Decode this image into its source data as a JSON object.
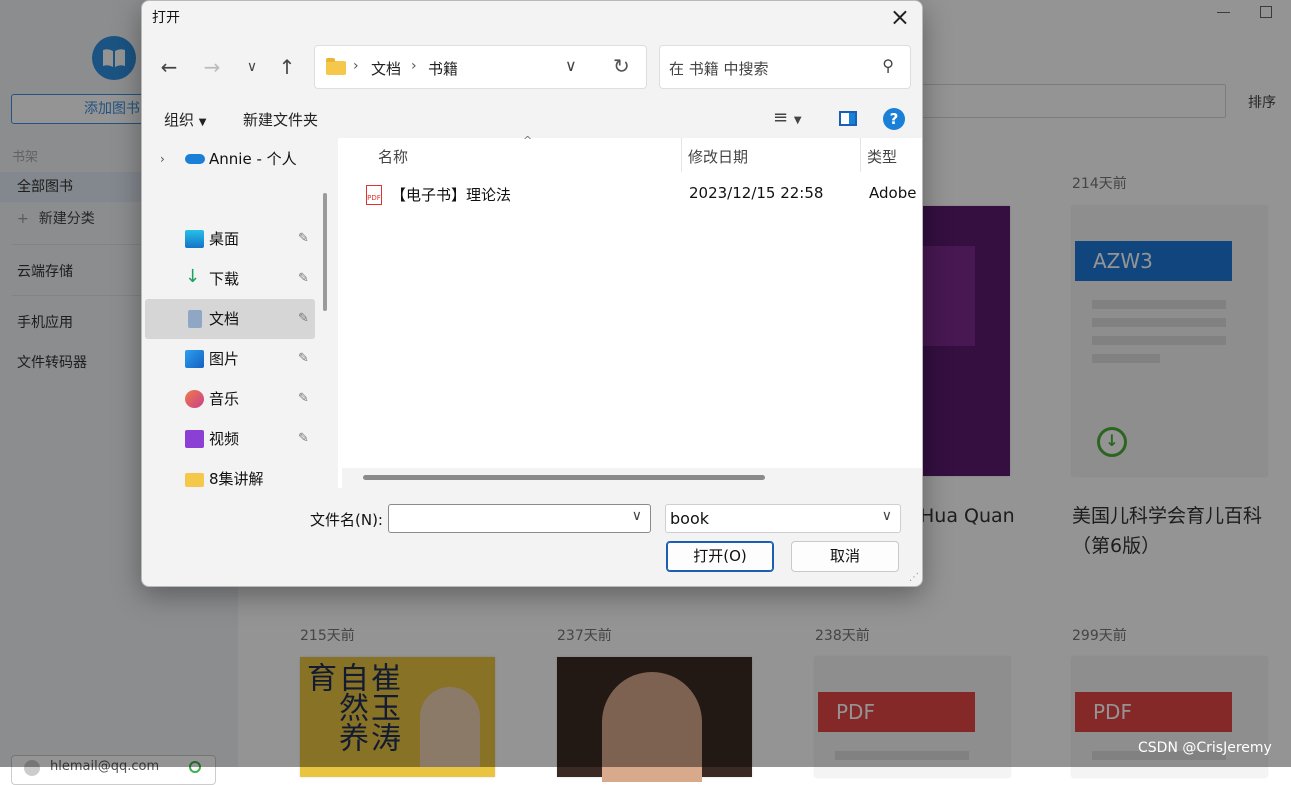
{
  "app": {
    "add_book": "添加图书",
    "shelf_heading": "书架",
    "all_books": "全部图书",
    "new_category": "新建分类",
    "cloud_storage": "云端存储",
    "mobile_app": "手机应用",
    "file_converter": "文件转码器",
    "account": "hlemail@qq.com",
    "sort": "排序",
    "books_row1": [
      {
        "days": "",
        "title": "Hua Quan",
        "cover_label": ""
      },
      {
        "days": "214天前",
        "title": "美国儿科学会育儿百科（第6版）",
        "cover_label": "AZW3"
      }
    ],
    "books_row2": [
      {
        "days": "215天前"
      },
      {
        "days": "237天前"
      },
      {
        "days": "238天前",
        "cover_label": "PDF"
      },
      {
        "days": "299天前",
        "cover_label": "PDF"
      }
    ],
    "row2_cover1_text": "崔玉涛 自然养育",
    "watermark": "CSDN @CrisJeremy"
  },
  "dialog": {
    "title": "打开",
    "close_icon": "×",
    "breadcrumb": [
      "文档",
      "书籍"
    ],
    "search_placeholder": "在 书籍 中搜索",
    "toolbar": {
      "organize": "组织",
      "new_folder": "新建文件夹",
      "help": "?"
    },
    "nav_items": [
      {
        "label": "Annie - 个人",
        "icon": "onedrive-icon"
      },
      {
        "label": "桌面",
        "icon": "desktop-icon",
        "pinned": true
      },
      {
        "label": "下载",
        "icon": "download-icon",
        "pinned": true
      },
      {
        "label": "文档",
        "icon": "documents-icon",
        "pinned": true,
        "selected": true
      },
      {
        "label": "图片",
        "icon": "pictures-icon",
        "pinned": true
      },
      {
        "label": "音乐",
        "icon": "music-icon",
        "pinned": true
      },
      {
        "label": "视频",
        "icon": "video-icon",
        "pinned": true
      },
      {
        "label": "8集讲解",
        "icon": "folder-icon"
      }
    ],
    "columns": [
      "名称",
      "修改日期",
      "类型"
    ],
    "files": [
      {
        "name": "【电子书】理论法",
        "modified": "2023/12/15 22:58",
        "type": "Adobe"
      }
    ],
    "filename_label": "文件名(N):",
    "filename_value": "",
    "filter_value": "book",
    "open_button": "打开(O)",
    "cancel_button": "取消"
  }
}
